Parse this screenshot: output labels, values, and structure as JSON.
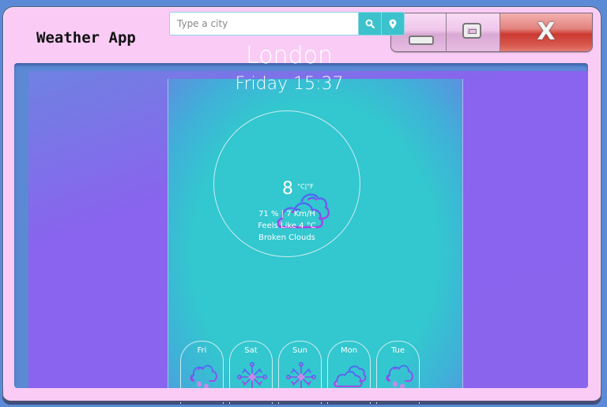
{
  "window": {
    "title": "Weather App",
    "controls": {
      "minimize": "minimize",
      "maximize": "maximize",
      "close": "X"
    }
  },
  "search": {
    "placeholder": "Type a city",
    "value": "",
    "search_icon": "search-icon",
    "location_icon": "map-pin-icon"
  },
  "current": {
    "city": "London",
    "datetime": "Friday 15:37",
    "icon": "broken-clouds-icon",
    "temperature": "8",
    "unit_toggle": "°C|°F",
    "humidity_wind": "71 % | 7 Km/H",
    "feels_like": "Feels Like 4 °C",
    "description": "Broken Clouds"
  },
  "forecast": [
    {
      "day": "Fri",
      "icon": "rain-cloud-icon"
    },
    {
      "day": "Sat",
      "icon": "snowflake-icon"
    },
    {
      "day": "Sun",
      "icon": "snowflake-icon"
    },
    {
      "day": "Mon",
      "icon": "broken-clouds-icon"
    },
    {
      "day": "Tue",
      "icon": "rain-cloud-icon"
    }
  ],
  "colors": {
    "titlebar": "#f9cbf5",
    "page_background": "#8b64ee",
    "app_background": "#33c7cf",
    "icon_gradient_start": "#4a6cf5",
    "icon_gradient_end": "#b13ee6",
    "close_button": "#cc3a30"
  }
}
